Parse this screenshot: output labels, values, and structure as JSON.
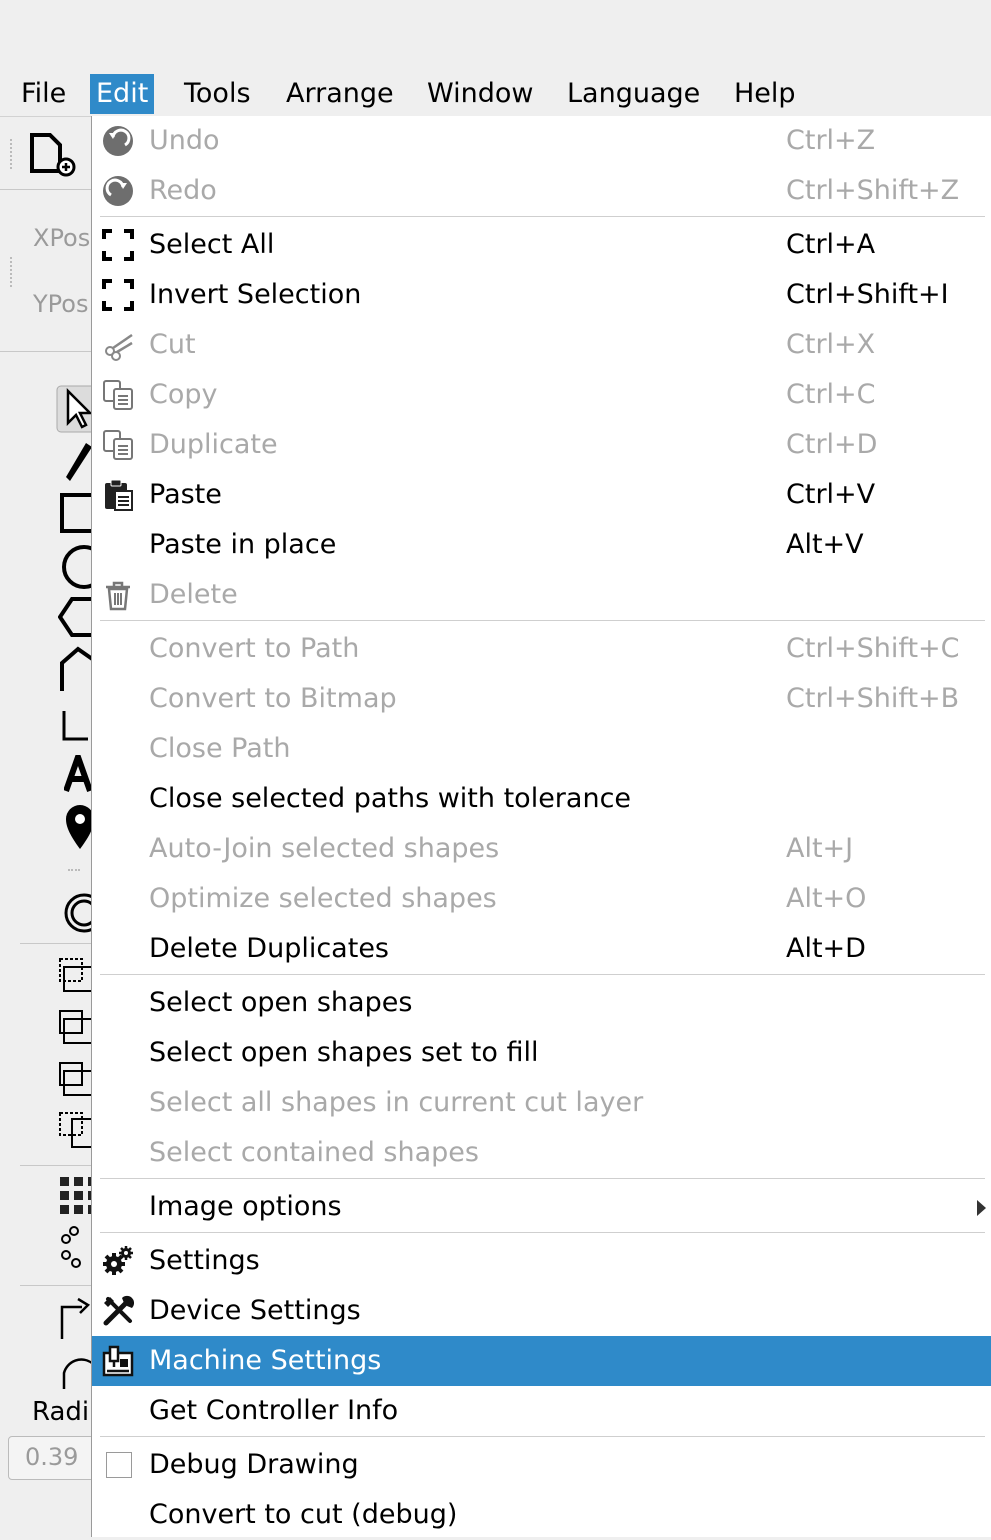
{
  "menubar": {
    "items": [
      {
        "label": "File"
      },
      {
        "label": "Edit"
      },
      {
        "label": "Tools"
      },
      {
        "label": "Arrange"
      },
      {
        "label": "Window"
      },
      {
        "label": "Language"
      },
      {
        "label": "Help"
      }
    ],
    "active": "Edit"
  },
  "background": {
    "xpos_label": "XPos",
    "ypos_label": "YPos",
    "radius_label": "Radi",
    "radius_value": "0.39"
  },
  "edit_menu": {
    "items": [
      {
        "label": "Undo",
        "shortcut": "Ctrl+Z",
        "enabled": false,
        "icon": "undo-icon"
      },
      {
        "label": "Redo",
        "shortcut": "Ctrl+Shift+Z",
        "enabled": false,
        "icon": "redo-icon"
      },
      {
        "label": "Select All",
        "shortcut": "Ctrl+A",
        "enabled": true,
        "icon": "select-all-icon"
      },
      {
        "label": "Invert Selection",
        "shortcut": "Ctrl+Shift+I",
        "enabled": true,
        "icon": "invert-selection-icon"
      },
      {
        "label": "Cut",
        "shortcut": "Ctrl+X",
        "enabled": false,
        "icon": "scissors-icon"
      },
      {
        "label": "Copy",
        "shortcut": "Ctrl+C",
        "enabled": false,
        "icon": "copy-icon"
      },
      {
        "label": "Duplicate",
        "shortcut": "Ctrl+D",
        "enabled": false,
        "icon": "duplicate-icon"
      },
      {
        "label": "Paste",
        "shortcut": "Ctrl+V",
        "enabled": true,
        "icon": "paste-icon"
      },
      {
        "label": "Paste in place",
        "shortcut": "Alt+V",
        "enabled": true,
        "icon": ""
      },
      {
        "label": "Delete",
        "shortcut": "",
        "enabled": false,
        "icon": "trash-icon"
      },
      {
        "label": "Convert to Path",
        "shortcut": "Ctrl+Shift+C",
        "enabled": false
      },
      {
        "label": "Convert to Bitmap",
        "shortcut": "Ctrl+Shift+B",
        "enabled": false
      },
      {
        "label": "Close Path",
        "shortcut": "",
        "enabled": false
      },
      {
        "label": "Close selected paths with tolerance",
        "shortcut": "",
        "enabled": true
      },
      {
        "label": "Auto-Join selected shapes",
        "shortcut": "Alt+J",
        "enabled": false
      },
      {
        "label": "Optimize selected shapes",
        "shortcut": "Alt+O",
        "enabled": false
      },
      {
        "label": "Delete Duplicates",
        "shortcut": "Alt+D",
        "enabled": true
      },
      {
        "label": "Select open shapes",
        "shortcut": "",
        "enabled": true
      },
      {
        "label": "Select open shapes set to fill",
        "shortcut": "",
        "enabled": true
      },
      {
        "label": "Select all shapes in current cut layer",
        "shortcut": "",
        "enabled": false
      },
      {
        "label": "Select contained shapes",
        "shortcut": "",
        "enabled": false
      },
      {
        "label": "Image options",
        "shortcut": "",
        "enabled": true,
        "submenu": true
      },
      {
        "label": "Settings",
        "shortcut": "",
        "enabled": true,
        "icon": "gears-icon"
      },
      {
        "label": "Device Settings",
        "shortcut": "",
        "enabled": true,
        "icon": "tools-icon"
      },
      {
        "label": "Machine Settings",
        "shortcut": "",
        "enabled": true,
        "icon": "machine-icon",
        "highlighted": true
      },
      {
        "label": "Get Controller Info",
        "shortcut": "",
        "enabled": true
      },
      {
        "label": "Debug Drawing",
        "shortcut": "",
        "enabled": true,
        "checkbox": true,
        "checked": false
      },
      {
        "label": "Convert to cut (debug)",
        "shortcut": "",
        "enabled": true
      }
    ]
  },
  "colors": {
    "highlight": "#2f8ac9",
    "disabled_text": "#a9a9a9",
    "menu_bg": "#ffffff",
    "window_bg": "#efefef"
  }
}
